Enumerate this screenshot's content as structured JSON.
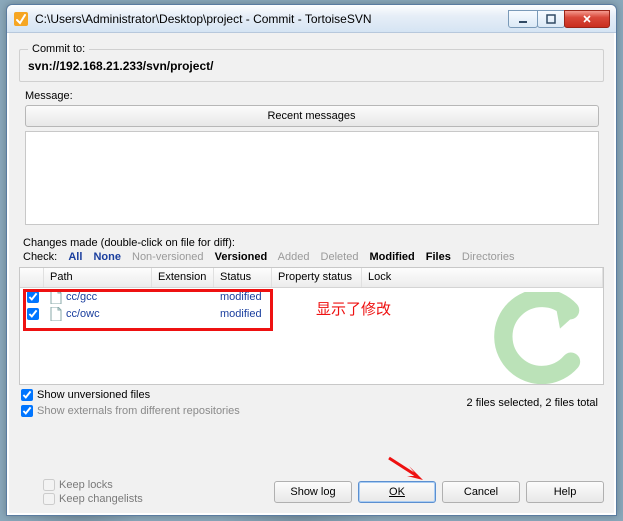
{
  "window": {
    "title": "C:\\Users\\Administrator\\Desktop\\project - Commit - TortoiseSVN"
  },
  "commit_to": {
    "legend": "Commit to:",
    "url": "svn://192.168.21.233/svn/project/"
  },
  "message": {
    "label": "Message:",
    "recent_btn": "Recent messages",
    "value": ""
  },
  "changes": {
    "label": "Changes made (double-click on file for diff):",
    "check_prefix": "Check:",
    "filters": {
      "all": "All",
      "none": "None",
      "non_versioned": "Non-versioned",
      "versioned": "Versioned",
      "added": "Added",
      "deleted": "Deleted",
      "modified": "Modified",
      "files": "Files",
      "directories": "Directories"
    },
    "columns": {
      "path": "Path",
      "extension": "Extension",
      "status": "Status",
      "property_status": "Property status",
      "lock": "Lock"
    },
    "rows": [
      {
        "checked": true,
        "path": "cc/gcc",
        "extension": "",
        "status": "modified",
        "property_status": "",
        "lock": ""
      },
      {
        "checked": true,
        "path": "cc/owc",
        "extension": "",
        "status": "modified",
        "property_status": "",
        "lock": ""
      }
    ],
    "show_unversioned": {
      "label": "Show unversioned files",
      "checked": true
    },
    "show_externals": {
      "label": "Show externals from different repositories",
      "checked": true
    },
    "status_text": "2 files selected, 2 files total"
  },
  "locks": {
    "keep_locks": {
      "label": "Keep locks",
      "checked": false
    },
    "keep_changelists": {
      "label": "Keep changelists",
      "checked": false
    }
  },
  "buttons": {
    "show_log": "Show log",
    "ok": "OK",
    "cancel": "Cancel",
    "help": "Help"
  },
  "annotation": {
    "text": "显示了修改"
  }
}
